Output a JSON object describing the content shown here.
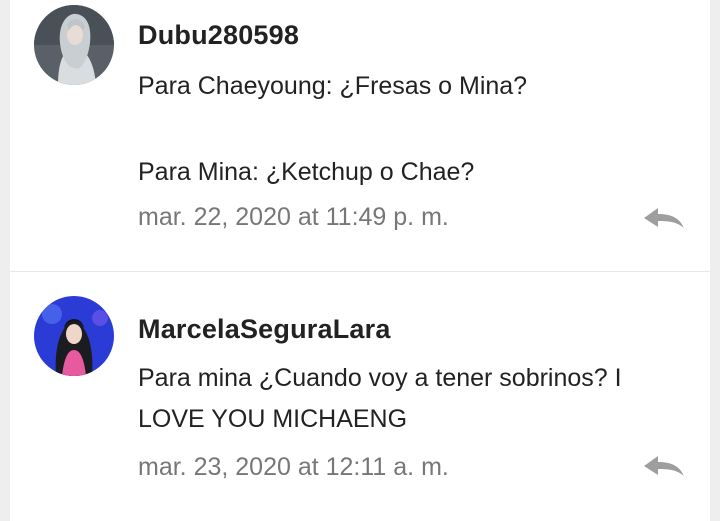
{
  "comments": [
    {
      "username": "Dubu280598",
      "lines": [
        "Para Chaeyoung: ¿Fresas o Mina?",
        "Para Mina: ¿Ketchup o Chae?"
      ],
      "timestamp": "mar. 22, 2020 at 11:49 p. m."
    },
    {
      "username": "MarcelaSeguraLara",
      "lines": [
        "Para mina ¿Cuando voy a tener sobrinos? I",
        "LOVE YOU MICHAENG"
      ],
      "timestamp": "mar. 23, 2020 at 12:11 a. m."
    }
  ],
  "colors": {
    "text": "#222222",
    "muted": "#777777",
    "icon": "#9e9e9e",
    "divider": "#e6e6e6"
  },
  "icons": {
    "reply": "reply-icon"
  }
}
